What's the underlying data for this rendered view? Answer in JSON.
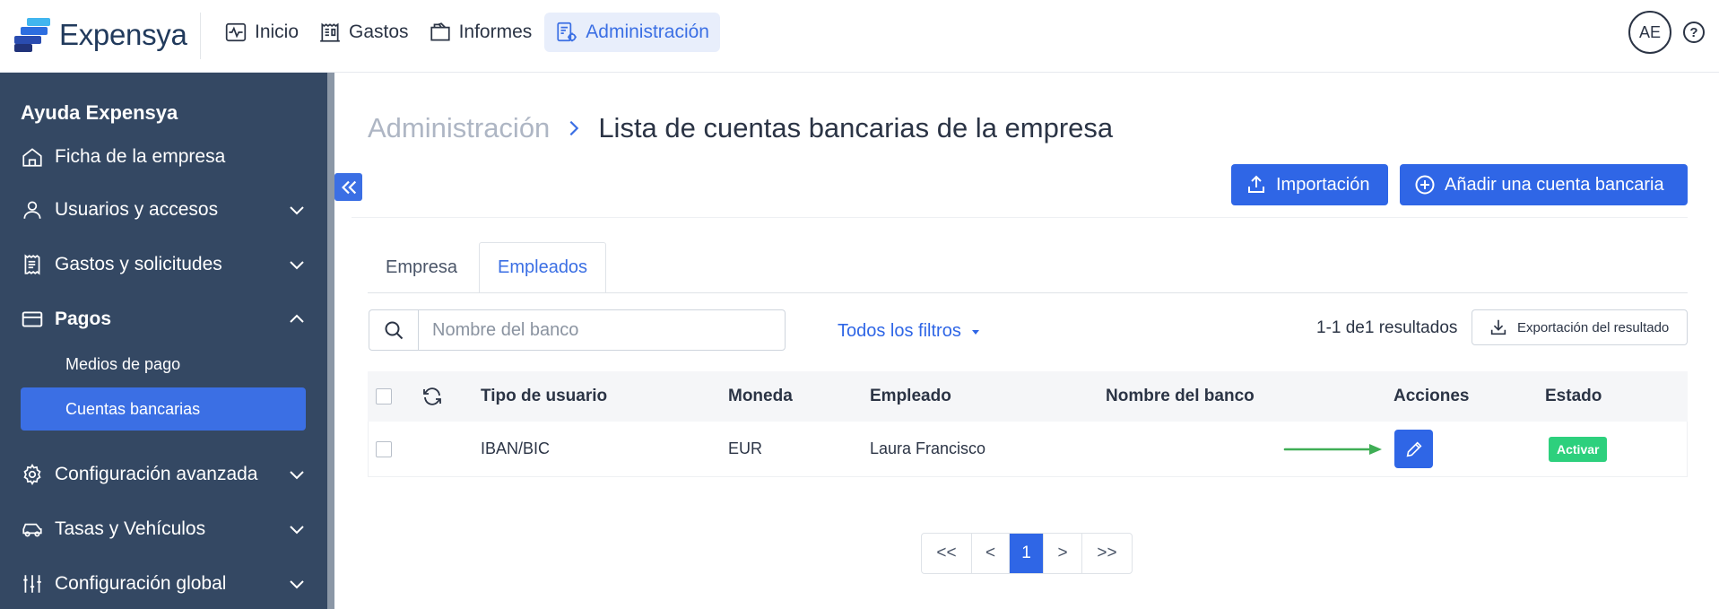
{
  "app": {
    "logo_text": "Expensya"
  },
  "topnav": {
    "items": [
      {
        "label": "Inicio",
        "icon": "activity-icon"
      },
      {
        "label": "Gastos",
        "icon": "receipt-icon"
      },
      {
        "label": "Informes",
        "icon": "folder-icon"
      },
      {
        "label": "Administración",
        "icon": "admin-settings-icon",
        "active": true
      }
    ],
    "avatar_initials": "AE",
    "help_glyph": "?"
  },
  "sidebar": {
    "title": "Ayuda Expensya",
    "items": [
      {
        "label": "Ficha de la empresa",
        "icon": "home-icon"
      },
      {
        "label": "Usuarios y accesos",
        "icon": "user-icon",
        "expandable": true
      },
      {
        "label": "Gastos y solicitudes",
        "icon": "receipt-icon",
        "expandable": true
      },
      {
        "label": "Pagos",
        "icon": "credit-card-icon",
        "expanded": true
      },
      {
        "label": "Configuración avanzada",
        "icon": "gear-icon",
        "expandable": true
      },
      {
        "label": "Tasas y Vehículos",
        "icon": "car-icon",
        "expandable": true
      },
      {
        "label": "Configuración global",
        "icon": "sliders-icon",
        "expandable": true
      }
    ],
    "subitems": [
      {
        "label": "Medios de pago"
      },
      {
        "label": "Cuentas bancarias",
        "active": true
      }
    ]
  },
  "breadcrumb": {
    "parent": "Administración",
    "current": "Lista de cuentas bancarias de la empresa"
  },
  "actions": {
    "import_label": "Importación",
    "add_label": "Añadir una cuenta bancaria"
  },
  "tabs": [
    {
      "label": "Empresa"
    },
    {
      "label": "Empleados",
      "active": true
    }
  ],
  "filters": {
    "search_placeholder": "Nombre del banco",
    "all_filters_label": "Todos los filtros",
    "results_text": "1-1 de1 resultados",
    "export_label": "Exportación del resultado"
  },
  "table": {
    "columns": [
      "Tipo de usuario",
      "Moneda",
      "Empleado",
      "Nombre del banco",
      "Acciones",
      "Estado"
    ],
    "rows": [
      {
        "tipo": "IBAN/BIC",
        "moneda": "EUR",
        "empleado": "Laura Francisco",
        "banco": "",
        "estado": "Activar"
      }
    ]
  },
  "pagination": {
    "first": "<<",
    "prev": "<",
    "current": "1",
    "next": ">",
    "last": ">>"
  },
  "colors": {
    "primary": "#2f66e6",
    "sidebar_bg": "#344863",
    "status_active": "#2dd07d",
    "annotation_arrow": "#3fae55"
  }
}
